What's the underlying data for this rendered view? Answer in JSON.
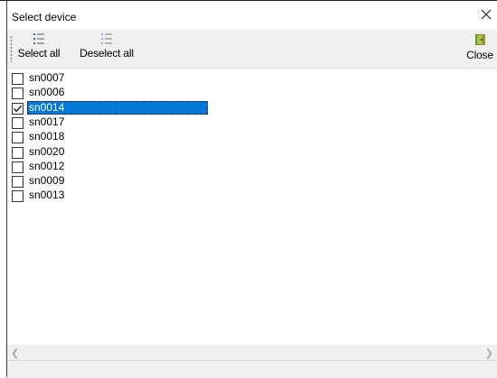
{
  "window": {
    "title": "Select device"
  },
  "toolbar": {
    "select_all_label": "Select all",
    "deselect_all_label": "Deselect all",
    "close_label": "Close"
  },
  "devices": [
    {
      "name": "sn0007",
      "checked": false,
      "selected": false
    },
    {
      "name": "sn0006",
      "checked": false,
      "selected": false
    },
    {
      "name": "sn0014",
      "checked": true,
      "selected": true
    },
    {
      "name": "sn0017",
      "checked": false,
      "selected": false
    },
    {
      "name": "sn0018",
      "checked": false,
      "selected": false
    },
    {
      "name": "sn0020",
      "checked": false,
      "selected": false
    },
    {
      "name": "sn0012",
      "checked": false,
      "selected": false
    },
    {
      "name": "sn0009",
      "checked": false,
      "selected": false
    },
    {
      "name": "sn0013",
      "checked": false,
      "selected": false
    }
  ],
  "colors": {
    "selection": "#0078d7",
    "toolbar_bg": "#f0f0f0",
    "list_icon": "#3a6fb7"
  },
  "icons": {
    "select_all": "list-icon",
    "deselect_all": "list-icon",
    "close": "exit-door-icon",
    "window_close": "close-icon",
    "scroll_left": "chevron-left-icon",
    "scroll_right": "chevron-right-icon"
  }
}
